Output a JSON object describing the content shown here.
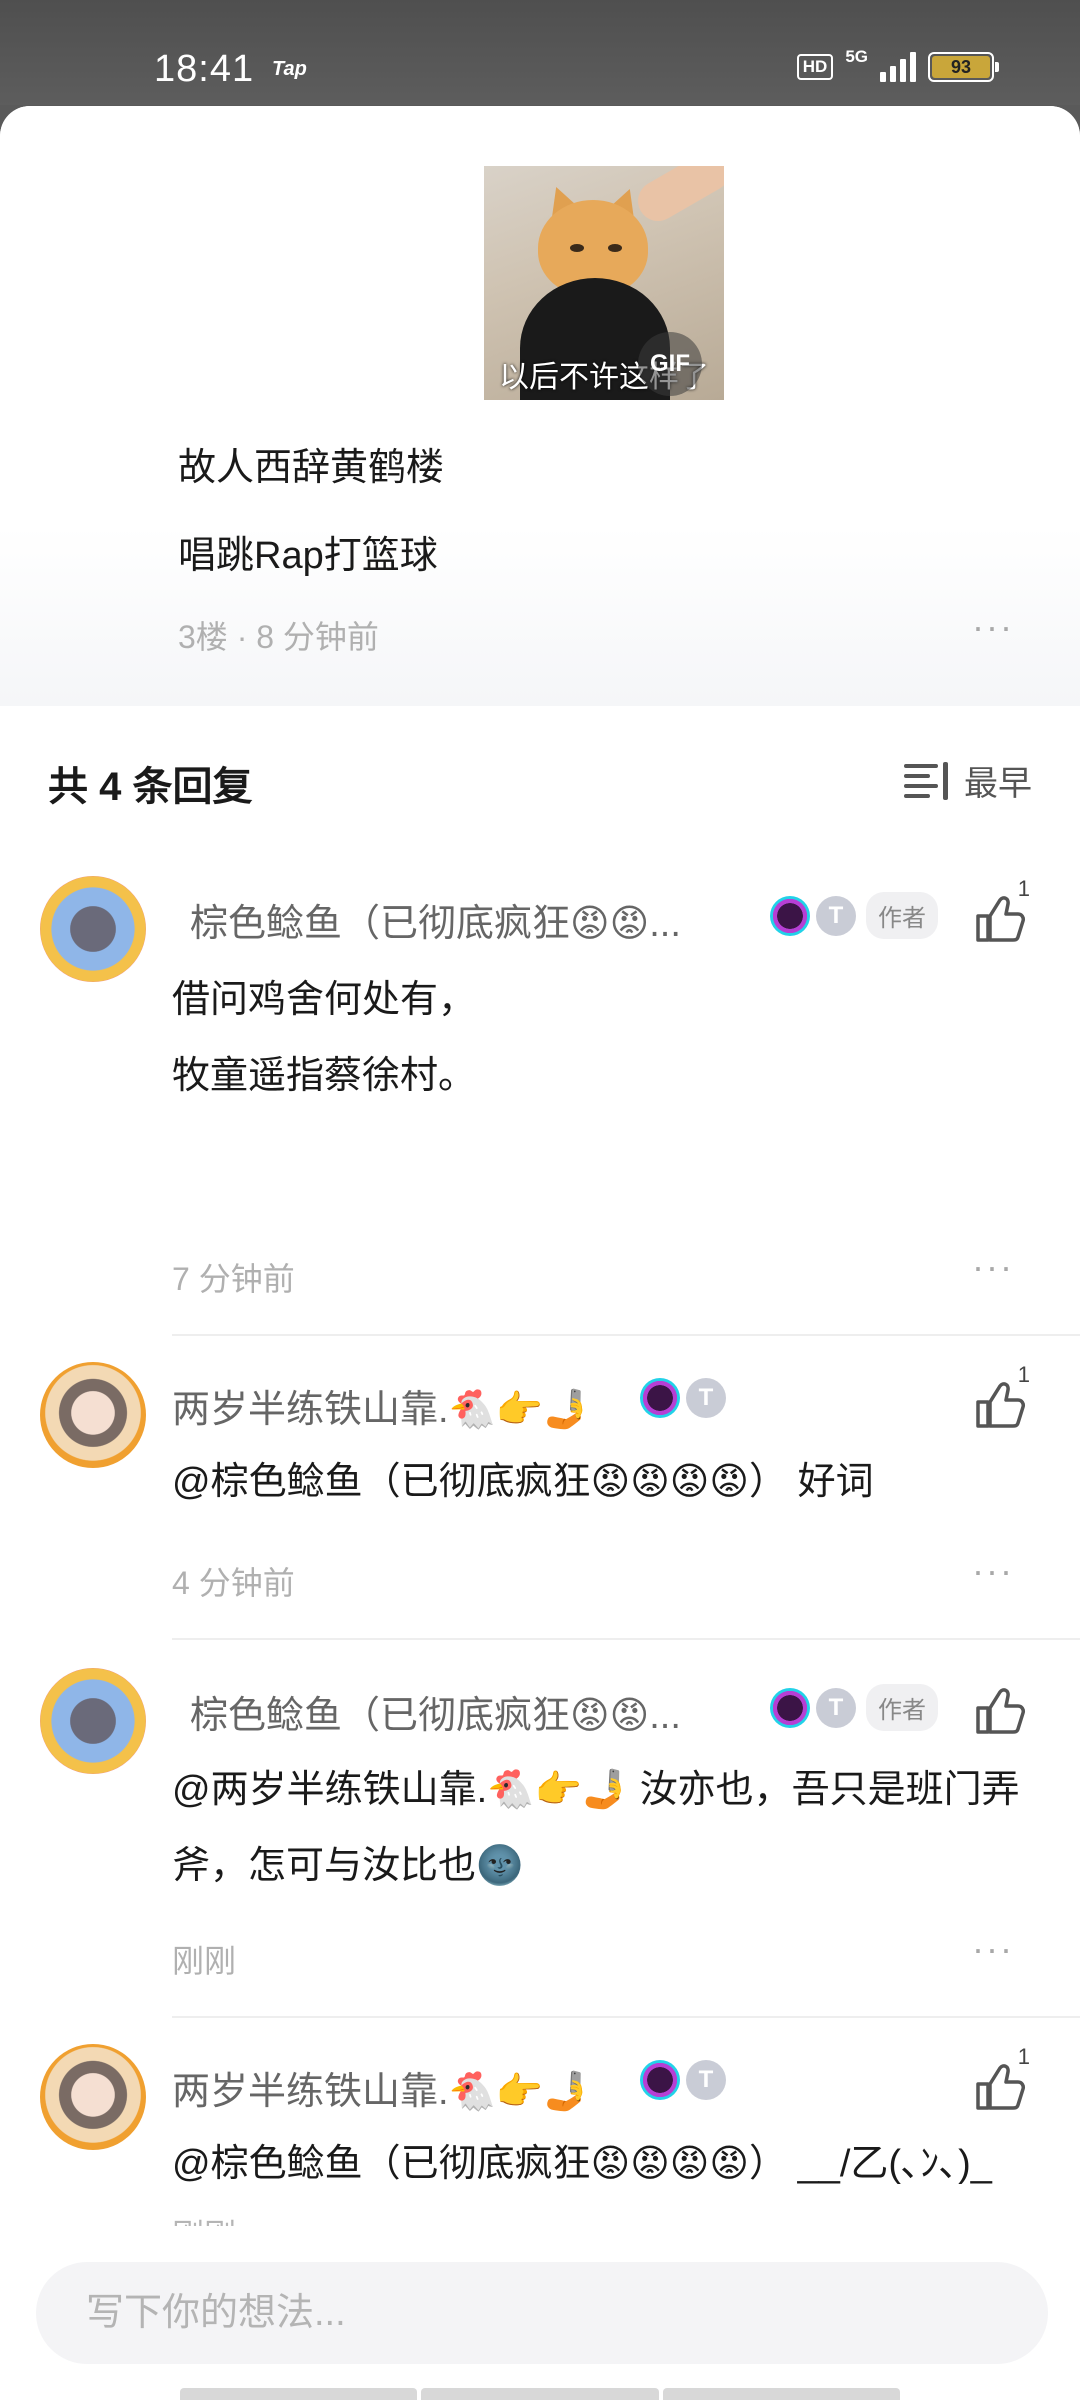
{
  "status_bar": {
    "time": "18:41",
    "app_indicator": "Tap",
    "hd": "HD",
    "network": "5G",
    "battery": "93",
    "battery_color": "#c9a63a"
  },
  "main_comment": {
    "gif_badge": "GIF",
    "gif_caption": "以后不许这样了",
    "lines": [
      "故人西辞黄鹤楼",
      "唱跳Rap打篮球"
    ],
    "meta": "3楼 · 8 分钟前",
    "more": "···"
  },
  "replies_header": {
    "title": "共 4 条回复",
    "sort_label": "最早",
    "sort_icon": "sort-earliest-icon"
  },
  "replies": [
    {
      "username": "棕色鲶鱼（已彻底疯狂😡😡...",
      "badge_t_level": "T",
      "author_tag": "作者",
      "likes": "1",
      "text": "借问鸡舍何处有，\n牧童遥指蔡徐村。",
      "time": "7 分钟前"
    },
    {
      "username": "两岁半练铁山靠.🐔👉🤳",
      "badge_t_level": "T",
      "likes": "1",
      "text": "@棕色鲶鱼（已彻底疯狂😡😡😡😡） 好词",
      "time": "4 分钟前"
    },
    {
      "username": "棕色鲶鱼（已彻底疯狂😡😡...",
      "badge_t_level": "T",
      "author_tag": "作者",
      "likes": "",
      "text": "@两岁半练铁山靠.🐔👉🤳 汝亦也，吾只是班门弄斧，怎可与汝比也🌚",
      "time": "刚刚"
    },
    {
      "username": "两岁半练铁山靠.🐔👉🤳",
      "badge_t_level": "T",
      "likes": "1",
      "text": "@棕色鲶鱼（已彻底疯狂😡😡😡😡） __/乙(､ﾝ､)_",
      "time": "刚刚"
    }
  ],
  "input": {
    "placeholder": "写下你的想法..."
  },
  "colors": {
    "accent_gray": "#666666",
    "meta_gray": "#b0b0b0"
  }
}
